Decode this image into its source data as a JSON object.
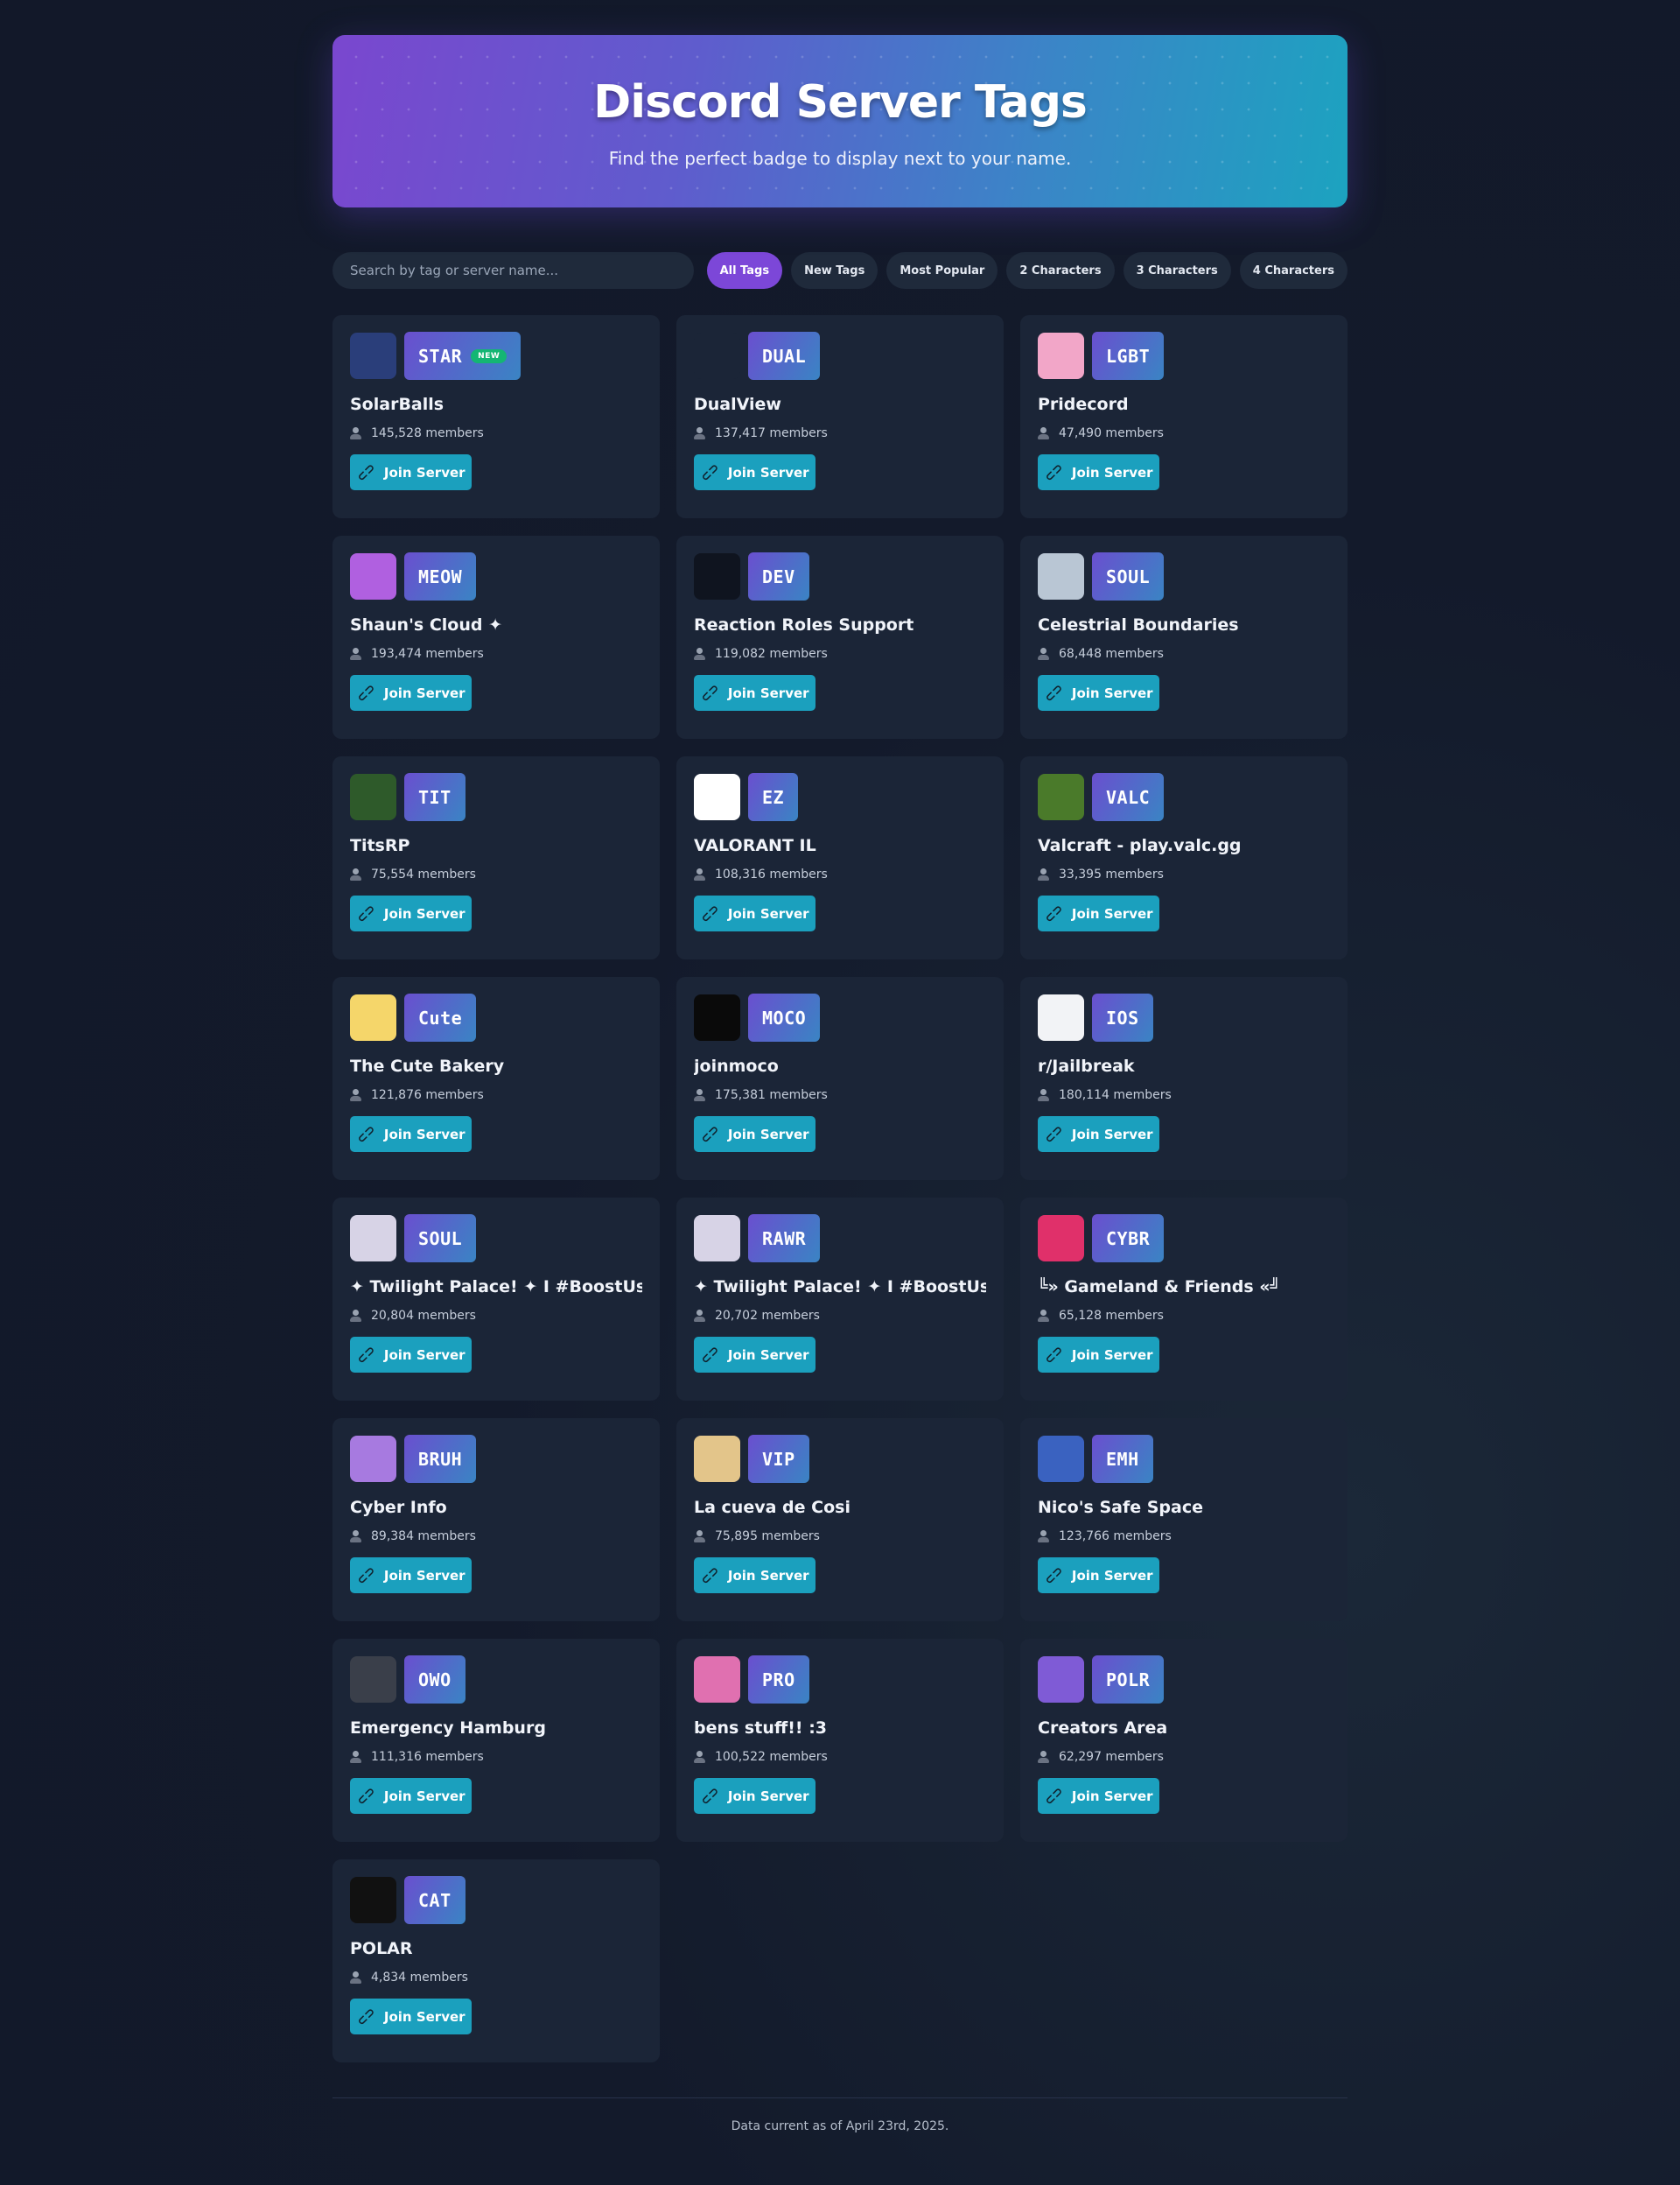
{
  "header": {
    "title": "Discord Server Tags",
    "subtitle": "Find the perfect badge to display next to your name."
  },
  "search": {
    "placeholder": "Search by tag or server name..."
  },
  "filters": [
    {
      "label": "All Tags",
      "active": true
    },
    {
      "label": "New Tags",
      "active": false
    },
    {
      "label": "Most Popular",
      "active": false
    },
    {
      "label": "2 Characters",
      "active": false
    },
    {
      "label": "3 Characters",
      "active": false
    },
    {
      "label": "4 Characters",
      "active": false
    }
  ],
  "join_label": "Join Server",
  "new_badge": "NEW",
  "servers": [
    {
      "tag": "STAR",
      "name": "SolarBalls",
      "members": "145,528 members",
      "is_new": true,
      "icon": "planet-icon",
      "color": "#2a3e7a"
    },
    {
      "tag": "DUAL",
      "name": "DualView",
      "members": "137,417 members",
      "icon": "headset-icon",
      "color": "#1b2537"
    },
    {
      "tag": "LGBT",
      "name": "Pridecord",
      "members": "47,490 members",
      "icon": "rainbow-cat-icon",
      "color": "#f2a6c8"
    },
    {
      "tag": "MEOW",
      "name": "Shaun's Cloud ✦",
      "members": "193,474 members",
      "icon": "pink-cat-icon",
      "color": "#b060e0"
    },
    {
      "tag": "DEV",
      "name": "Reaction Roles Support",
      "members": "119,082 members",
      "icon": "nodes-icon",
      "color": "#0f141f"
    },
    {
      "tag": "SOUL",
      "name": "Celestrial Boundaries",
      "members": "68,448 members",
      "icon": "blue-creature-icon",
      "color": "#b9c6d4"
    },
    {
      "tag": "TIT",
      "name": "TitsRP",
      "members": "75,554 members",
      "icon": "frog-icon",
      "color": "#2e5a2a"
    },
    {
      "tag": "EZ",
      "name": "VALORANT IL",
      "members": "108,316 members",
      "icon": "valorant-flag-icon",
      "color": "#ffffff"
    },
    {
      "tag": "VALC",
      "name": "Valcraft - play.valc.gg",
      "members": "33,395 members",
      "icon": "valorant-grass-icon",
      "color": "#4a7a2a"
    },
    {
      "tag": "Cute",
      "name": "The Cute Bakery",
      "members": "121,876 members",
      "icon": "bunny-icon",
      "color": "#f5d66a"
    },
    {
      "tag": "MOCO",
      "name": "joinmoco",
      "members": "175,381 members",
      "icon": "cube-logo-icon",
      "color": "#0a0a0a"
    },
    {
      "tag": "IOS",
      "name": "r/Jailbreak",
      "members": "180,114 members",
      "icon": "lock-icon",
      "color": "#f2f3f6"
    },
    {
      "tag": "SOUL",
      "name": "✦ Twilight Palace! ✦ I #BoostUs",
      "members": "20,804 members",
      "icon": "anime-girl-icon",
      "color": "#d7d3e6"
    },
    {
      "tag": "RAWR",
      "name": "✦ Twilight Palace! ✦ I #BoostUs",
      "members": "20,702 members",
      "icon": "anime-girl-icon",
      "color": "#d7d3e6"
    },
    {
      "tag": "CYBR",
      "name": "╚» Gameland & Friends «╝",
      "members": "65,128 members",
      "icon": "gameland-icon",
      "color": "#e0306a"
    },
    {
      "tag": "BRUH",
      "name": "Cyber Info",
      "members": "89,384 members",
      "icon": "chevron-logo-icon",
      "color": "#a77ae0"
    },
    {
      "tag": "VIP",
      "name": "La cueva de Cosi",
      "members": "75,895 members",
      "icon": "bear-icon",
      "color": "#e3c58a"
    },
    {
      "tag": "EMH",
      "name": "Nico's Safe Space",
      "members": "123,766 members",
      "icon": "anime-boy-icon",
      "color": "#3a62c0"
    },
    {
      "tag": "OWO",
      "name": "Emergency Hamburg",
      "members": "111,316 members",
      "icon": "eh-logo-icon",
      "color": "#3a3f4a"
    },
    {
      "tag": "PRO",
      "name": "bens stuff!! :3",
      "members": "100,522 members",
      "icon": "rainbow-fox-icon",
      "color": "#e070b0"
    },
    {
      "tag": "POLR",
      "name": "Creators Area",
      "members": "62,297 members",
      "icon": "crystal-icon",
      "color": "#7f5bd6"
    },
    {
      "tag": "CAT",
      "name": "POLAR",
      "members": "4,834 members",
      "icon": "polar-bear-icon",
      "color": "#111111"
    }
  ],
  "footer": {
    "text": "Data current as of April 23rd, 2025."
  }
}
